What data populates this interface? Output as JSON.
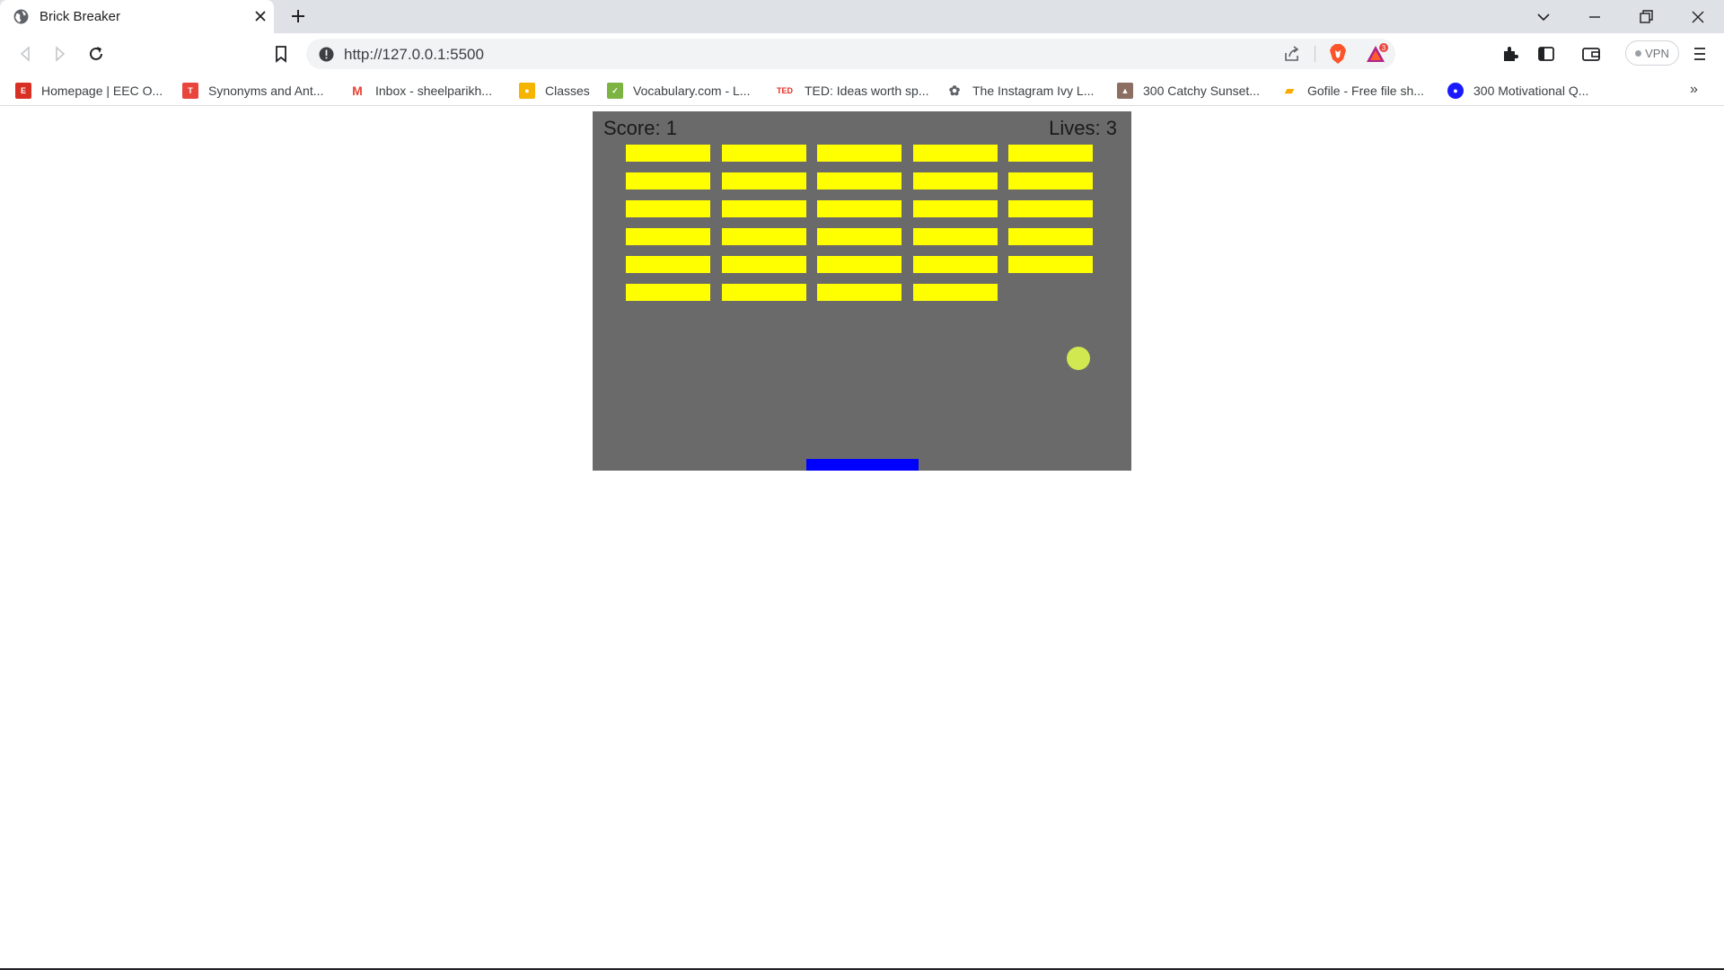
{
  "browser": {
    "tab": {
      "title": "Brick Breaker",
      "favicon": "globe-icon"
    },
    "address_bar": {
      "url": "http://127.0.0.1:5500"
    },
    "vpn_label": "VPN",
    "rewards_badge": "3"
  },
  "bookmarks": [
    {
      "label": "Homepage | EEC O...",
      "icon": "eec-icon",
      "color": "#d93025"
    },
    {
      "label": "Synonyms and Ant...",
      "icon": "thesaurus-icon",
      "color": "#e8453c"
    },
    {
      "label": "Inbox - sheelparikh...",
      "icon": "gmail-icon",
      "color": "#ea4335"
    },
    {
      "label": "Classes",
      "icon": "classroom-icon",
      "color": "#f4b400"
    },
    {
      "label": "Vocabulary.com - L...",
      "icon": "vocabulary-icon",
      "color": "#7cb342"
    },
    {
      "label": "TED: Ideas worth sp...",
      "icon": "ted-icon",
      "color": "#e62b1e"
    },
    {
      "label": "The Instagram Ivy L...",
      "icon": "ivy-icon",
      "color": "#5f6368"
    },
    {
      "label": "300 Catchy Sunset...",
      "icon": "sunset-icon",
      "color": "#8d6e63"
    },
    {
      "label": "Gofile - Free file sh...",
      "icon": "gofile-icon",
      "color": "#f9ab00"
    },
    {
      "label": "300 Motivational Q...",
      "icon": "motivational-icon",
      "color": "#1a1aff"
    }
  ],
  "game": {
    "score_label": "Score: 1",
    "lives_label": "Lives: 3",
    "score": 1,
    "lives": 3,
    "brick_color": "#ffff00",
    "background_color": "#6b6a6b",
    "paddle_color": "#0000ff",
    "ball_color": "#d2e850",
    "brick_rows": [
      [
        1,
        1,
        1,
        1,
        1
      ],
      [
        1,
        1,
        1,
        1,
        1
      ],
      [
        1,
        1,
        1,
        1,
        1
      ],
      [
        1,
        1,
        1,
        1,
        1
      ],
      [
        1,
        1,
        1,
        1,
        1
      ],
      [
        1,
        1,
        1,
        1,
        0
      ]
    ]
  }
}
